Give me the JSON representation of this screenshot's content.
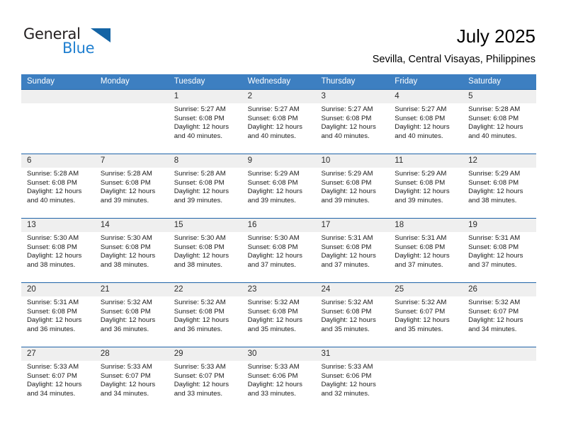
{
  "brand": {
    "name_part1": "General",
    "name_part2": "Blue",
    "triangle_icon": "brand-triangle-icon",
    "color_black": "#231f20",
    "color_blue": "#1f7fd0"
  },
  "header": {
    "title": "July 2025",
    "subtitle": "Sevilla, Central Visayas, Philippines"
  },
  "theme": {
    "header_bg": "#3d7fc1",
    "header_text": "#ffffff",
    "week_divider": "#1f63a8",
    "daynum_bg": "#efefef"
  },
  "weekdays": [
    "Sunday",
    "Monday",
    "Tuesday",
    "Wednesday",
    "Thursday",
    "Friday",
    "Saturday"
  ],
  "weeks": [
    [
      {
        "day": "",
        "sunrise": "",
        "sunset": "",
        "daylight_line1": "",
        "daylight_line2": ""
      },
      {
        "day": "",
        "sunrise": "",
        "sunset": "",
        "daylight_line1": "",
        "daylight_line2": ""
      },
      {
        "day": "1",
        "sunrise": "Sunrise: 5:27 AM",
        "sunset": "Sunset: 6:08 PM",
        "daylight_line1": "Daylight: 12 hours",
        "daylight_line2": "and 40 minutes."
      },
      {
        "day": "2",
        "sunrise": "Sunrise: 5:27 AM",
        "sunset": "Sunset: 6:08 PM",
        "daylight_line1": "Daylight: 12 hours",
        "daylight_line2": "and 40 minutes."
      },
      {
        "day": "3",
        "sunrise": "Sunrise: 5:27 AM",
        "sunset": "Sunset: 6:08 PM",
        "daylight_line1": "Daylight: 12 hours",
        "daylight_line2": "and 40 minutes."
      },
      {
        "day": "4",
        "sunrise": "Sunrise: 5:27 AM",
        "sunset": "Sunset: 6:08 PM",
        "daylight_line1": "Daylight: 12 hours",
        "daylight_line2": "and 40 minutes."
      },
      {
        "day": "5",
        "sunrise": "Sunrise: 5:28 AM",
        "sunset": "Sunset: 6:08 PM",
        "daylight_line1": "Daylight: 12 hours",
        "daylight_line2": "and 40 minutes."
      }
    ],
    [
      {
        "day": "6",
        "sunrise": "Sunrise: 5:28 AM",
        "sunset": "Sunset: 6:08 PM",
        "daylight_line1": "Daylight: 12 hours",
        "daylight_line2": "and 40 minutes."
      },
      {
        "day": "7",
        "sunrise": "Sunrise: 5:28 AM",
        "sunset": "Sunset: 6:08 PM",
        "daylight_line1": "Daylight: 12 hours",
        "daylight_line2": "and 39 minutes."
      },
      {
        "day": "8",
        "sunrise": "Sunrise: 5:28 AM",
        "sunset": "Sunset: 6:08 PM",
        "daylight_line1": "Daylight: 12 hours",
        "daylight_line2": "and 39 minutes."
      },
      {
        "day": "9",
        "sunrise": "Sunrise: 5:29 AM",
        "sunset": "Sunset: 6:08 PM",
        "daylight_line1": "Daylight: 12 hours",
        "daylight_line2": "and 39 minutes."
      },
      {
        "day": "10",
        "sunrise": "Sunrise: 5:29 AM",
        "sunset": "Sunset: 6:08 PM",
        "daylight_line1": "Daylight: 12 hours",
        "daylight_line2": "and 39 minutes."
      },
      {
        "day": "11",
        "sunrise": "Sunrise: 5:29 AM",
        "sunset": "Sunset: 6:08 PM",
        "daylight_line1": "Daylight: 12 hours",
        "daylight_line2": "and 39 minutes."
      },
      {
        "day": "12",
        "sunrise": "Sunrise: 5:29 AM",
        "sunset": "Sunset: 6:08 PM",
        "daylight_line1": "Daylight: 12 hours",
        "daylight_line2": "and 38 minutes."
      }
    ],
    [
      {
        "day": "13",
        "sunrise": "Sunrise: 5:30 AM",
        "sunset": "Sunset: 6:08 PM",
        "daylight_line1": "Daylight: 12 hours",
        "daylight_line2": "and 38 minutes."
      },
      {
        "day": "14",
        "sunrise": "Sunrise: 5:30 AM",
        "sunset": "Sunset: 6:08 PM",
        "daylight_line1": "Daylight: 12 hours",
        "daylight_line2": "and 38 minutes."
      },
      {
        "day": "15",
        "sunrise": "Sunrise: 5:30 AM",
        "sunset": "Sunset: 6:08 PM",
        "daylight_line1": "Daylight: 12 hours",
        "daylight_line2": "and 38 minutes."
      },
      {
        "day": "16",
        "sunrise": "Sunrise: 5:30 AM",
        "sunset": "Sunset: 6:08 PM",
        "daylight_line1": "Daylight: 12 hours",
        "daylight_line2": "and 37 minutes."
      },
      {
        "day": "17",
        "sunrise": "Sunrise: 5:31 AM",
        "sunset": "Sunset: 6:08 PM",
        "daylight_line1": "Daylight: 12 hours",
        "daylight_line2": "and 37 minutes."
      },
      {
        "day": "18",
        "sunrise": "Sunrise: 5:31 AM",
        "sunset": "Sunset: 6:08 PM",
        "daylight_line1": "Daylight: 12 hours",
        "daylight_line2": "and 37 minutes."
      },
      {
        "day": "19",
        "sunrise": "Sunrise: 5:31 AM",
        "sunset": "Sunset: 6:08 PM",
        "daylight_line1": "Daylight: 12 hours",
        "daylight_line2": "and 37 minutes."
      }
    ],
    [
      {
        "day": "20",
        "sunrise": "Sunrise: 5:31 AM",
        "sunset": "Sunset: 6:08 PM",
        "daylight_line1": "Daylight: 12 hours",
        "daylight_line2": "and 36 minutes."
      },
      {
        "day": "21",
        "sunrise": "Sunrise: 5:32 AM",
        "sunset": "Sunset: 6:08 PM",
        "daylight_line1": "Daylight: 12 hours",
        "daylight_line2": "and 36 minutes."
      },
      {
        "day": "22",
        "sunrise": "Sunrise: 5:32 AM",
        "sunset": "Sunset: 6:08 PM",
        "daylight_line1": "Daylight: 12 hours",
        "daylight_line2": "and 36 minutes."
      },
      {
        "day": "23",
        "sunrise": "Sunrise: 5:32 AM",
        "sunset": "Sunset: 6:08 PM",
        "daylight_line1": "Daylight: 12 hours",
        "daylight_line2": "and 35 minutes."
      },
      {
        "day": "24",
        "sunrise": "Sunrise: 5:32 AM",
        "sunset": "Sunset: 6:08 PM",
        "daylight_line1": "Daylight: 12 hours",
        "daylight_line2": "and 35 minutes."
      },
      {
        "day": "25",
        "sunrise": "Sunrise: 5:32 AM",
        "sunset": "Sunset: 6:07 PM",
        "daylight_line1": "Daylight: 12 hours",
        "daylight_line2": "and 35 minutes."
      },
      {
        "day": "26",
        "sunrise": "Sunrise: 5:32 AM",
        "sunset": "Sunset: 6:07 PM",
        "daylight_line1": "Daylight: 12 hours",
        "daylight_line2": "and 34 minutes."
      }
    ],
    [
      {
        "day": "27",
        "sunrise": "Sunrise: 5:33 AM",
        "sunset": "Sunset: 6:07 PM",
        "daylight_line1": "Daylight: 12 hours",
        "daylight_line2": "and 34 minutes."
      },
      {
        "day": "28",
        "sunrise": "Sunrise: 5:33 AM",
        "sunset": "Sunset: 6:07 PM",
        "daylight_line1": "Daylight: 12 hours",
        "daylight_line2": "and 34 minutes."
      },
      {
        "day": "29",
        "sunrise": "Sunrise: 5:33 AM",
        "sunset": "Sunset: 6:07 PM",
        "daylight_line1": "Daylight: 12 hours",
        "daylight_line2": "and 33 minutes."
      },
      {
        "day": "30",
        "sunrise": "Sunrise: 5:33 AM",
        "sunset": "Sunset: 6:06 PM",
        "daylight_line1": "Daylight: 12 hours",
        "daylight_line2": "and 33 minutes."
      },
      {
        "day": "31",
        "sunrise": "Sunrise: 5:33 AM",
        "sunset": "Sunset: 6:06 PM",
        "daylight_line1": "Daylight: 12 hours",
        "daylight_line2": "and 32 minutes."
      },
      {
        "day": "",
        "sunrise": "",
        "sunset": "",
        "daylight_line1": "",
        "daylight_line2": ""
      },
      {
        "day": "",
        "sunrise": "",
        "sunset": "",
        "daylight_line1": "",
        "daylight_line2": ""
      }
    ]
  ]
}
